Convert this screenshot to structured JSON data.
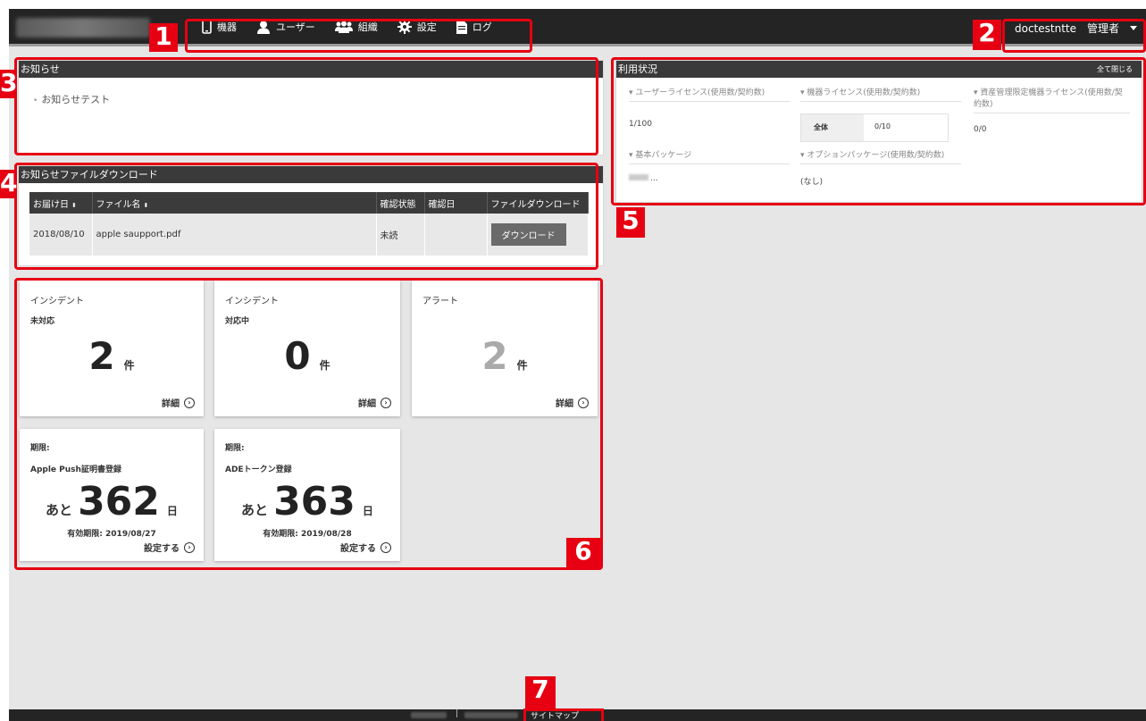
{
  "header": {
    "nav": [
      {
        "label": "機器",
        "icon": "smartphone-icon"
      },
      {
        "label": "ユーザー",
        "icon": "user-icon"
      },
      {
        "label": "組織",
        "icon": "users-group-icon"
      },
      {
        "label": "設定",
        "icon": "gear-icon"
      },
      {
        "label": "ログ",
        "icon": "document-icon"
      }
    ],
    "username": "doctestntte",
    "role": "管理者"
  },
  "news": {
    "title": "お知らせ",
    "items": [
      "お知らせテスト"
    ]
  },
  "file_download": {
    "title": "お知らせファイルダウンロード",
    "columns": [
      "お届け日",
      "ファイル名",
      "確認状態",
      "確認日",
      "ファイルダウンロード"
    ],
    "rows": [
      {
        "date": "2018/08/10",
        "file": "apple saupport.pdf",
        "status": "未読",
        "confirmed": "",
        "button": "ダウンロード"
      }
    ]
  },
  "cards": [
    {
      "title": "インシデント",
      "sub": "未対応",
      "count": "2",
      "unit": "件",
      "link": "詳細"
    },
    {
      "title": "インシデント",
      "sub": "対応中",
      "count": "0",
      "unit": "件",
      "link": "詳細"
    },
    {
      "title": "アラート",
      "sub": "",
      "count": "2",
      "unit": "件",
      "link": "詳細"
    }
  ],
  "deadlines": [
    {
      "label": "期限:",
      "name": "Apple Push証明書登録",
      "prefix": "あと",
      "days": "362",
      "unit": "日",
      "expiry": "有効期限: 2019/08/27",
      "link": "設定する"
    },
    {
      "label": "期限:",
      "name": "ADEトークン登録",
      "prefix": "あと",
      "days": "363",
      "unit": "日",
      "expiry": "有効期限: 2019/08/28",
      "link": "設定する"
    }
  ],
  "usage": {
    "title": "利用状況",
    "collapse_all": "全て閉じる",
    "user_license": {
      "label": "ユーザーライセンス(使用数/契約数)",
      "value": "1/100"
    },
    "device_license": {
      "label": "機器ライセンス(使用数/契約数)",
      "key": "全体",
      "value": "0/10"
    },
    "asset_license": {
      "label": "資産管理限定機器ライセンス(使用数/契約数)",
      "value": "0/0"
    },
    "basic_package": {
      "label": "基本パッケージ",
      "value": "..."
    },
    "option_package": {
      "label": "オプションパッケージ(使用数/契約数)",
      "value": "(なし)"
    }
  },
  "footer": {
    "sep": "|",
    "sitemap": "サイトマップ"
  },
  "markers": [
    "1",
    "2",
    "3",
    "4",
    "5",
    "6",
    "7"
  ],
  "colors": {
    "marker": "#e60012",
    "header": "#242424",
    "panel_head": "#3a3a3a"
  }
}
